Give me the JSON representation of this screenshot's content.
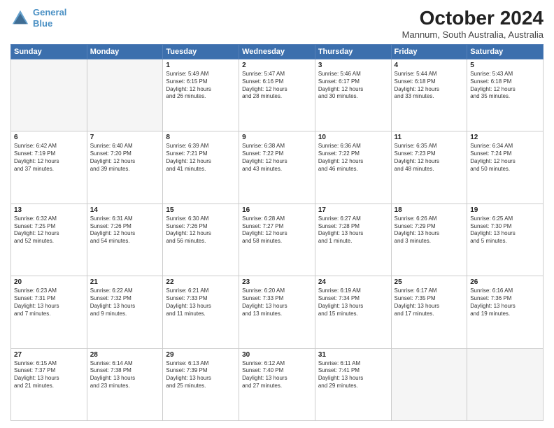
{
  "header": {
    "logo_line1": "General",
    "logo_line2": "Blue",
    "title": "October 2024",
    "subtitle": "Mannum, South Australia, Australia"
  },
  "days": [
    "Sunday",
    "Monday",
    "Tuesday",
    "Wednesday",
    "Thursday",
    "Friday",
    "Saturday"
  ],
  "weeks": [
    [
      {
        "day": "",
        "content": ""
      },
      {
        "day": "",
        "content": ""
      },
      {
        "day": "1",
        "content": "Sunrise: 5:49 AM\nSunset: 6:15 PM\nDaylight: 12 hours\nand 26 minutes."
      },
      {
        "day": "2",
        "content": "Sunrise: 5:47 AM\nSunset: 6:16 PM\nDaylight: 12 hours\nand 28 minutes."
      },
      {
        "day": "3",
        "content": "Sunrise: 5:46 AM\nSunset: 6:17 PM\nDaylight: 12 hours\nand 30 minutes."
      },
      {
        "day": "4",
        "content": "Sunrise: 5:44 AM\nSunset: 6:18 PM\nDaylight: 12 hours\nand 33 minutes."
      },
      {
        "day": "5",
        "content": "Sunrise: 5:43 AM\nSunset: 6:18 PM\nDaylight: 12 hours\nand 35 minutes."
      }
    ],
    [
      {
        "day": "6",
        "content": "Sunrise: 6:42 AM\nSunset: 7:19 PM\nDaylight: 12 hours\nand 37 minutes."
      },
      {
        "day": "7",
        "content": "Sunrise: 6:40 AM\nSunset: 7:20 PM\nDaylight: 12 hours\nand 39 minutes."
      },
      {
        "day": "8",
        "content": "Sunrise: 6:39 AM\nSunset: 7:21 PM\nDaylight: 12 hours\nand 41 minutes."
      },
      {
        "day": "9",
        "content": "Sunrise: 6:38 AM\nSunset: 7:22 PM\nDaylight: 12 hours\nand 43 minutes."
      },
      {
        "day": "10",
        "content": "Sunrise: 6:36 AM\nSunset: 7:22 PM\nDaylight: 12 hours\nand 46 minutes."
      },
      {
        "day": "11",
        "content": "Sunrise: 6:35 AM\nSunset: 7:23 PM\nDaylight: 12 hours\nand 48 minutes."
      },
      {
        "day": "12",
        "content": "Sunrise: 6:34 AM\nSunset: 7:24 PM\nDaylight: 12 hours\nand 50 minutes."
      }
    ],
    [
      {
        "day": "13",
        "content": "Sunrise: 6:32 AM\nSunset: 7:25 PM\nDaylight: 12 hours\nand 52 minutes."
      },
      {
        "day": "14",
        "content": "Sunrise: 6:31 AM\nSunset: 7:26 PM\nDaylight: 12 hours\nand 54 minutes."
      },
      {
        "day": "15",
        "content": "Sunrise: 6:30 AM\nSunset: 7:26 PM\nDaylight: 12 hours\nand 56 minutes."
      },
      {
        "day": "16",
        "content": "Sunrise: 6:28 AM\nSunset: 7:27 PM\nDaylight: 12 hours\nand 58 minutes."
      },
      {
        "day": "17",
        "content": "Sunrise: 6:27 AM\nSunset: 7:28 PM\nDaylight: 13 hours\nand 1 minute."
      },
      {
        "day": "18",
        "content": "Sunrise: 6:26 AM\nSunset: 7:29 PM\nDaylight: 13 hours\nand 3 minutes."
      },
      {
        "day": "19",
        "content": "Sunrise: 6:25 AM\nSunset: 7:30 PM\nDaylight: 13 hours\nand 5 minutes."
      }
    ],
    [
      {
        "day": "20",
        "content": "Sunrise: 6:23 AM\nSunset: 7:31 PM\nDaylight: 13 hours\nand 7 minutes."
      },
      {
        "day": "21",
        "content": "Sunrise: 6:22 AM\nSunset: 7:32 PM\nDaylight: 13 hours\nand 9 minutes."
      },
      {
        "day": "22",
        "content": "Sunrise: 6:21 AM\nSunset: 7:33 PM\nDaylight: 13 hours\nand 11 minutes."
      },
      {
        "day": "23",
        "content": "Sunrise: 6:20 AM\nSunset: 7:33 PM\nDaylight: 13 hours\nand 13 minutes."
      },
      {
        "day": "24",
        "content": "Sunrise: 6:19 AM\nSunset: 7:34 PM\nDaylight: 13 hours\nand 15 minutes."
      },
      {
        "day": "25",
        "content": "Sunrise: 6:17 AM\nSunset: 7:35 PM\nDaylight: 13 hours\nand 17 minutes."
      },
      {
        "day": "26",
        "content": "Sunrise: 6:16 AM\nSunset: 7:36 PM\nDaylight: 13 hours\nand 19 minutes."
      }
    ],
    [
      {
        "day": "27",
        "content": "Sunrise: 6:15 AM\nSunset: 7:37 PM\nDaylight: 13 hours\nand 21 minutes."
      },
      {
        "day": "28",
        "content": "Sunrise: 6:14 AM\nSunset: 7:38 PM\nDaylight: 13 hours\nand 23 minutes."
      },
      {
        "day": "29",
        "content": "Sunrise: 6:13 AM\nSunset: 7:39 PM\nDaylight: 13 hours\nand 25 minutes."
      },
      {
        "day": "30",
        "content": "Sunrise: 6:12 AM\nSunset: 7:40 PM\nDaylight: 13 hours\nand 27 minutes."
      },
      {
        "day": "31",
        "content": "Sunrise: 6:11 AM\nSunset: 7:41 PM\nDaylight: 13 hours\nand 29 minutes."
      },
      {
        "day": "",
        "content": ""
      },
      {
        "day": "",
        "content": ""
      }
    ]
  ]
}
